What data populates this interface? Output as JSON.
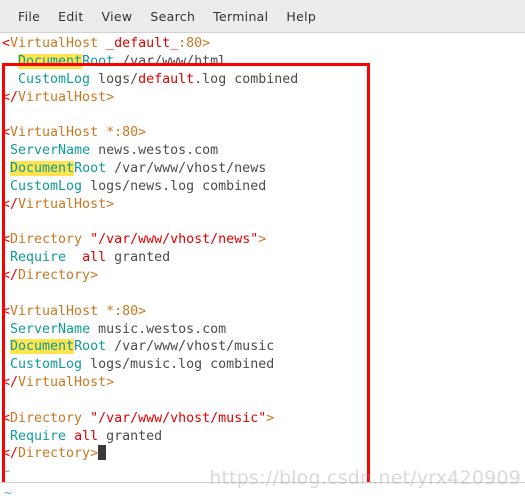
{
  "window": {
    "kind": "terminal-text-editor",
    "background": "#ffffff"
  },
  "menubar": {
    "items": [
      {
        "label": "File"
      },
      {
        "label": "Edit"
      },
      {
        "label": "View"
      },
      {
        "label": "Search"
      },
      {
        "label": "Terminal"
      },
      {
        "label": "Help"
      }
    ]
  },
  "colors": {
    "tag_bracket_red": "#e00000",
    "tag_name_orange": "#c87822",
    "directive_teal": "#119a9a",
    "value_grey": "#4c4c4c",
    "string_red": "#e00000",
    "search_highlight": "#ffe44d",
    "annotation_box": "#ff0000",
    "tilde_blue": "#6c9ec6",
    "cursor": "#3a3a3a"
  },
  "editor": {
    "search_term": "Document",
    "lines": [
      {
        "i": 0,
        "text": "<VirtualHost _default_:80>"
      },
      {
        "i": 1,
        "text": "  DocumentRoot /var/www/html"
      },
      {
        "i": 2,
        "text": "  CustomLog logs/default.log combined"
      },
      {
        "i": 3,
        "text": "</VirtualHost>"
      },
      {
        "i": 4,
        "text": ""
      },
      {
        "i": 5,
        "text": "<VirtualHost *:80>"
      },
      {
        "i": 6,
        "text": " ServerName news.westos.com"
      },
      {
        "i": 7,
        "text": " DocumentRoot /var/www/vhost/news"
      },
      {
        "i": 8,
        "text": " CustomLog logs/news.log combined"
      },
      {
        "i": 9,
        "text": "</VirtualHost>"
      },
      {
        "i": 10,
        "text": ""
      },
      {
        "i": 11,
        "text": "<Directory \"/var/www/vhost/news\">"
      },
      {
        "i": 12,
        "text": " Require  all granted"
      },
      {
        "i": 13,
        "text": "</Directory>"
      },
      {
        "i": 14,
        "text": ""
      },
      {
        "i": 15,
        "text": "<VirtualHost *:80>"
      },
      {
        "i": 16,
        "text": " ServerName music.westos.com"
      },
      {
        "i": 17,
        "text": " DocumentRoot /var/www/vhost/music"
      },
      {
        "i": 18,
        "text": " CustomLog logs/music.log combined"
      },
      {
        "i": 19,
        "text": "</VirtualHost>"
      },
      {
        "i": 20,
        "text": ""
      },
      {
        "i": 21,
        "text": "<Directory \"/var/www/vhost/music\">"
      },
      {
        "i": 22,
        "text": " Require all granted"
      },
      {
        "i": 23,
        "text": "</Directory>"
      }
    ],
    "empty_line_marker": "~",
    "tilde_lines": [
      "~",
      "~"
    ]
  },
  "tokens": {
    "l0": [
      [
        "<",
        "red"
      ],
      [
        "VirtualHost",
        "org"
      ],
      [
        " ",
        "grey"
      ],
      [
        "_default_",
        "red"
      ],
      [
        ":80>",
        "org"
      ]
    ],
    "l1": [
      [
        "  ",
        "grey"
      ],
      [
        "Document",
        "hl"
      ],
      [
        "Root",
        "teal"
      ],
      [
        " /var/www/html",
        "grey"
      ]
    ],
    "l2": [
      [
        "  ",
        "grey"
      ],
      [
        "CustomLog",
        "teal"
      ],
      [
        " logs/",
        "grey"
      ],
      [
        "default",
        "red"
      ],
      [
        ".log combined",
        "grey"
      ]
    ],
    "l3": [
      [
        "</",
        "red"
      ],
      [
        "VirtualHost",
        "org"
      ],
      [
        ">",
        "org"
      ]
    ],
    "l5": [
      [
        "<",
        "red"
      ],
      [
        "VirtualHost",
        "org"
      ],
      [
        " ",
        "grey"
      ],
      [
        "*:80>",
        "org"
      ]
    ],
    "l6": [
      [
        " ",
        "grey"
      ],
      [
        "ServerName",
        "teal"
      ],
      [
        " news.westos.com",
        "grey"
      ]
    ],
    "l7": [
      [
        " ",
        "grey"
      ],
      [
        "Document",
        "hl"
      ],
      [
        "Root",
        "teal"
      ],
      [
        " /var/www/vhost/news",
        "grey"
      ]
    ],
    "l8": [
      [
        " ",
        "grey"
      ],
      [
        "CustomLog",
        "teal"
      ],
      [
        " logs/news.log combined",
        "grey"
      ]
    ],
    "l9": [
      [
        "</",
        "red"
      ],
      [
        "VirtualHost",
        "org"
      ],
      [
        ">",
        "org"
      ]
    ],
    "l11": [
      [
        "<",
        "red"
      ],
      [
        "Directory",
        "org"
      ],
      [
        " ",
        "grey"
      ],
      [
        "\"/var/www/vhost/news\"",
        "red"
      ],
      [
        ">",
        "org"
      ]
    ],
    "l12": [
      [
        " ",
        "grey"
      ],
      [
        "Require",
        "teal"
      ],
      [
        "  ",
        "grey"
      ],
      [
        "all",
        "red"
      ],
      [
        " granted",
        "grey"
      ]
    ],
    "l13": [
      [
        "</",
        "red"
      ],
      [
        "Directory",
        "org"
      ],
      [
        ">",
        "org"
      ]
    ],
    "l15": [
      [
        "<",
        "red"
      ],
      [
        "VirtualHost",
        "org"
      ],
      [
        " ",
        "grey"
      ],
      [
        "*:80>",
        "org"
      ]
    ],
    "l16": [
      [
        " ",
        "grey"
      ],
      [
        "ServerName",
        "teal"
      ],
      [
        " music.westos.com",
        "grey"
      ]
    ],
    "l17": [
      [
        " ",
        "grey"
      ],
      [
        "Document",
        "hl"
      ],
      [
        "Root",
        "teal"
      ],
      [
        " /var/www/vhost/music",
        "grey"
      ]
    ],
    "l18": [
      [
        " ",
        "grey"
      ],
      [
        "CustomLog",
        "teal"
      ],
      [
        " logs/music.log combined",
        "grey"
      ]
    ],
    "l19": [
      [
        "</",
        "red"
      ],
      [
        "VirtualHost",
        "org"
      ],
      [
        ">",
        "org"
      ]
    ],
    "l21": [
      [
        "<",
        "red"
      ],
      [
        "Directory",
        "org"
      ],
      [
        " ",
        "grey"
      ],
      [
        "\"/var/www/vhost/music\"",
        "red"
      ],
      [
        ">",
        "org"
      ]
    ],
    "l22": [
      [
        " ",
        "grey"
      ],
      [
        "Require",
        "teal"
      ],
      [
        " ",
        "grey"
      ],
      [
        "all",
        "red"
      ],
      [
        " granted",
        "grey"
      ]
    ],
    "l23": [
      [
        "</",
        "red"
      ],
      [
        "Directory",
        "org"
      ],
      [
        ">",
        "org"
      ],
      [
        "CURSOR",
        ""
      ]
    ]
  },
  "watermark": {
    "text": "https://blog.csdn.net/yrx420909"
  }
}
